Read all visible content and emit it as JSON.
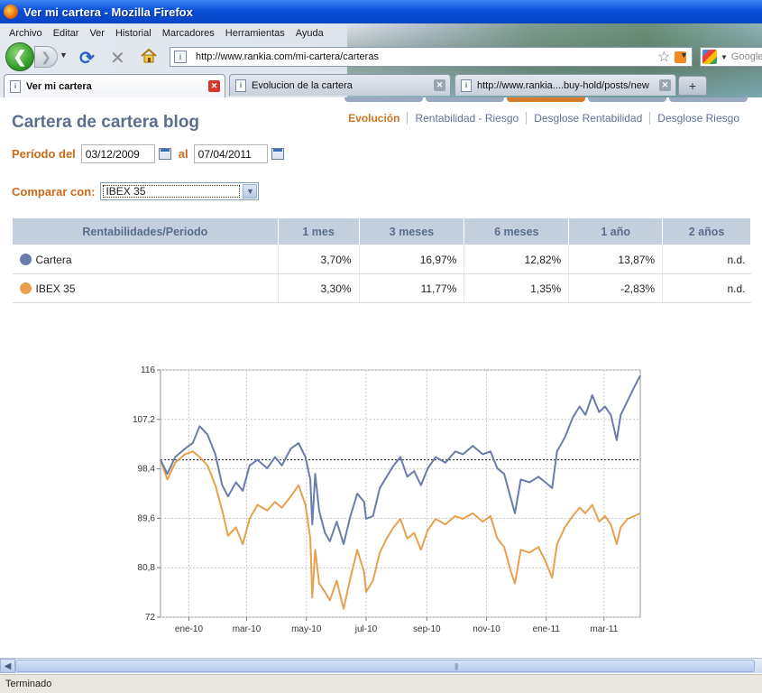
{
  "window": {
    "title": "Ver mi cartera - Mozilla Firefox"
  },
  "menu": [
    "Archivo",
    "Editar",
    "Ver",
    "Historial",
    "Marcadores",
    "Herramientas",
    "Ayuda"
  ],
  "navbar": {
    "url": "http://www.rankia.com/mi-cartera/carteras",
    "search_placeholder": "Google"
  },
  "tabs": [
    {
      "label": "Ver mi cartera",
      "active": true
    },
    {
      "label": "Evolucion de la cartera",
      "active": false
    },
    {
      "label": "http://www.rankia....buy-hold/posts/new",
      "active": false
    }
  ],
  "newtab_label": "+",
  "page": {
    "title": "Cartera de cartera blog",
    "views": [
      "Evolución",
      "Rentabilidad - Riesgo",
      "Desglose Rentabilidad",
      "Desglose Riesgo"
    ],
    "active_view": 0,
    "period_label": "Período del",
    "date_from": "03/12/2009",
    "date_to_label": "al",
    "date_to": "07/04/2011",
    "compare_label": "Comparar con:",
    "compare_value": "IBEX 35"
  },
  "table": {
    "headers": [
      "Rentabilidades/Periodo",
      "1 mes",
      "3 meses",
      "6 meses",
      "1 año",
      "2 años"
    ],
    "rows": [
      {
        "name": "Cartera",
        "color": "#6a7cab",
        "values": [
          "3,70%",
          "16,97%",
          "12,82%",
          "13,87%",
          "n.d."
        ]
      },
      {
        "name": "IBEX 35",
        "color": "#e7a04e",
        "values": [
          "3,30%",
          "11,77%",
          "1,35%",
          "-2,83%",
          "n.d."
        ]
      }
    ]
  },
  "chart_data": {
    "type": "line",
    "x_ticks": [
      "ene-10",
      "mar-10",
      "may-10",
      "jul-10",
      "sep-10",
      "nov-10",
      "ene-11",
      "mar-11"
    ],
    "x_range": [
      "2009-12-03",
      "2011-04-07"
    ],
    "y_ticks": [
      72,
      80.8,
      89.6,
      98.4,
      107.2,
      116
    ],
    "ylim": [
      72,
      116
    ],
    "reference_line": 100,
    "grid": true,
    "series": [
      {
        "color": "#6a7cab",
        "points": [
          [
            "2009-12-03",
            100
          ],
          [
            "2009-12-10",
            97.5
          ],
          [
            "2009-12-18",
            100.5
          ],
          [
            "2009-12-28",
            102
          ],
          [
            "2010-01-05",
            103
          ],
          [
            "2010-01-12",
            106
          ],
          [
            "2010-01-20",
            104.5
          ],
          [
            "2010-01-28",
            101
          ],
          [
            "2010-02-04",
            95.5
          ],
          [
            "2010-02-10",
            93.5
          ],
          [
            "2010-02-18",
            96
          ],
          [
            "2010-02-25",
            94.5
          ],
          [
            "2010-03-04",
            99
          ],
          [
            "2010-03-12",
            100
          ],
          [
            "2010-03-22",
            98.5
          ],
          [
            "2010-03-30",
            100.5
          ],
          [
            "2010-04-06",
            99
          ],
          [
            "2010-04-15",
            102
          ],
          [
            "2010-04-23",
            103
          ],
          [
            "2010-04-30",
            100.5
          ],
          [
            "2010-05-05",
            96.5
          ],
          [
            "2010-05-07",
            88.5
          ],
          [
            "2010-05-10",
            97.5
          ],
          [
            "2010-05-14",
            91
          ],
          [
            "2010-05-20",
            87
          ],
          [
            "2010-05-25",
            85.5
          ],
          [
            "2010-06-01",
            89
          ],
          [
            "2010-06-08",
            85
          ],
          [
            "2010-06-15",
            90
          ],
          [
            "2010-06-22",
            94
          ],
          [
            "2010-06-29",
            92.5
          ],
          [
            "2010-07-01",
            89.5
          ],
          [
            "2010-07-08",
            90
          ],
          [
            "2010-07-15",
            95
          ],
          [
            "2010-07-22",
            97
          ],
          [
            "2010-07-29",
            99
          ],
          [
            "2010-08-05",
            100.5
          ],
          [
            "2010-08-12",
            97
          ],
          [
            "2010-08-19",
            98
          ],
          [
            "2010-08-26",
            95.5
          ],
          [
            "2010-09-02",
            98.5
          ],
          [
            "2010-09-10",
            100.5
          ],
          [
            "2010-09-20",
            99.5
          ],
          [
            "2010-09-30",
            101.5
          ],
          [
            "2010-10-08",
            101
          ],
          [
            "2010-10-18",
            102.5
          ],
          [
            "2010-10-28",
            101
          ],
          [
            "2010-11-05",
            101.5
          ],
          [
            "2010-11-12",
            98.5
          ],
          [
            "2010-11-19",
            97.5
          ],
          [
            "2010-11-26",
            93
          ],
          [
            "2010-11-30",
            90.5
          ],
          [
            "2010-12-06",
            96.5
          ],
          [
            "2010-12-15",
            96
          ],
          [
            "2010-12-24",
            97
          ],
          [
            "2010-12-31",
            96
          ],
          [
            "2011-01-07",
            95
          ],
          [
            "2011-01-12",
            101.5
          ],
          [
            "2011-01-20",
            104
          ],
          [
            "2011-01-28",
            107.5
          ],
          [
            "2011-02-04",
            109.5
          ],
          [
            "2011-02-10",
            108
          ],
          [
            "2011-02-17",
            111.5
          ],
          [
            "2011-02-24",
            108.5
          ],
          [
            "2011-03-02",
            109.5
          ],
          [
            "2011-03-08",
            108
          ],
          [
            "2011-03-14",
            103.5
          ],
          [
            "2011-03-18",
            108
          ],
          [
            "2011-03-25",
            110.5
          ],
          [
            "2011-04-01",
            113
          ],
          [
            "2011-04-07",
            115
          ]
        ]
      },
      {
        "color": "#e7a04e",
        "points": [
          [
            "2009-12-03",
            100
          ],
          [
            "2009-12-10",
            96.5
          ],
          [
            "2009-12-18",
            99.5
          ],
          [
            "2009-12-28",
            101
          ],
          [
            "2010-01-05",
            101.5
          ],
          [
            "2010-01-12",
            100.5
          ],
          [
            "2010-01-20",
            99
          ],
          [
            "2010-01-28",
            95.5
          ],
          [
            "2010-02-04",
            91
          ],
          [
            "2010-02-10",
            86.5
          ],
          [
            "2010-02-18",
            88
          ],
          [
            "2010-02-25",
            85
          ],
          [
            "2010-03-04",
            89.5
          ],
          [
            "2010-03-12",
            92
          ],
          [
            "2010-03-22",
            91
          ],
          [
            "2010-03-30",
            92.5
          ],
          [
            "2010-04-06",
            91.5
          ],
          [
            "2010-04-15",
            93.5
          ],
          [
            "2010-04-23",
            95.5
          ],
          [
            "2010-04-30",
            92
          ],
          [
            "2010-05-05",
            86
          ],
          [
            "2010-05-07",
            75.5
          ],
          [
            "2010-05-10",
            84
          ],
          [
            "2010-05-14",
            78
          ],
          [
            "2010-05-20",
            76.5
          ],
          [
            "2010-05-25",
            75
          ],
          [
            "2010-06-01",
            78.5
          ],
          [
            "2010-06-08",
            73.5
          ],
          [
            "2010-06-15",
            79
          ],
          [
            "2010-06-22",
            84
          ],
          [
            "2010-06-29",
            80
          ],
          [
            "2010-07-01",
            76.5
          ],
          [
            "2010-07-08",
            78.5
          ],
          [
            "2010-07-15",
            83.5
          ],
          [
            "2010-07-22",
            86
          ],
          [
            "2010-07-29",
            88
          ],
          [
            "2010-08-05",
            89.5
          ],
          [
            "2010-08-12",
            86
          ],
          [
            "2010-08-19",
            87
          ],
          [
            "2010-08-26",
            84
          ],
          [
            "2010-09-02",
            87.5
          ],
          [
            "2010-09-10",
            89.5
          ],
          [
            "2010-09-20",
            88.5
          ],
          [
            "2010-09-30",
            90
          ],
          [
            "2010-10-08",
            89.5
          ],
          [
            "2010-10-18",
            90.5
          ],
          [
            "2010-10-28",
            89
          ],
          [
            "2010-11-05",
            90
          ],
          [
            "2010-11-12",
            86
          ],
          [
            "2010-11-19",
            84.5
          ],
          [
            "2010-11-26",
            80
          ],
          [
            "2010-11-30",
            78
          ],
          [
            "2010-12-06",
            84
          ],
          [
            "2010-12-15",
            83.5
          ],
          [
            "2010-12-24",
            84.5
          ],
          [
            "2010-12-31",
            82
          ],
          [
            "2011-01-07",
            79
          ],
          [
            "2011-01-12",
            85
          ],
          [
            "2011-01-20",
            88
          ],
          [
            "2011-01-28",
            90
          ],
          [
            "2011-02-04",
            91.5
          ],
          [
            "2011-02-10",
            90.5
          ],
          [
            "2011-02-17",
            92
          ],
          [
            "2011-02-24",
            89
          ],
          [
            "2011-03-02",
            90
          ],
          [
            "2011-03-08",
            88.5
          ],
          [
            "2011-03-14",
            85
          ],
          [
            "2011-03-18",
            88
          ],
          [
            "2011-03-25",
            89.5
          ],
          [
            "2011-04-01",
            90
          ],
          [
            "2011-04-07",
            90.5
          ]
        ]
      }
    ]
  },
  "statusbar": {
    "text": "Terminado"
  }
}
